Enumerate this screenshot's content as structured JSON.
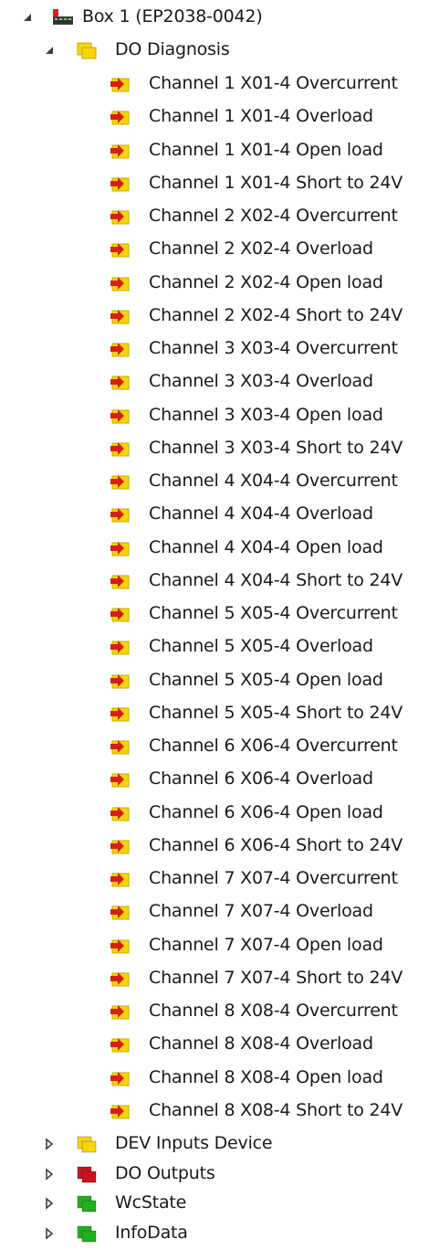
{
  "tree": {
    "root": {
      "label": "Box 1 (EP2038-0042)",
      "icon": "box-device-icon",
      "expanded": true
    },
    "diagnosis_group": {
      "label": "DO Diagnosis",
      "icon": "yellow-folder-icon",
      "expanded": true
    },
    "diagnosis_items": [
      "Channel 1 X01-4 Overcurrent",
      "Channel 1 X01-4 Overload",
      "Channel 1 X01-4 Open load",
      "Channel 1 X01-4 Short to 24V",
      "Channel 2 X02-4 Overcurrent",
      "Channel 2 X02-4 Overload",
      "Channel 2 X02-4 Open load",
      "Channel 2 X02-4 Short to 24V",
      "Channel 3 X03-4 Overcurrent",
      "Channel 3 X03-4 Overload",
      "Channel 3 X03-4 Open load",
      "Channel 3 X03-4 Short to 24V",
      "Channel 4 X04-4 Overcurrent",
      "Channel 4 X04-4 Overload",
      "Channel 4 X04-4 Open load",
      "Channel 4 X04-4 Short to 24V",
      "Channel 5 X05-4 Overcurrent",
      "Channel 5 X05-4 Overload",
      "Channel 5 X05-4 Open load",
      "Channel 5 X05-4 Short to 24V",
      "Channel 6 X06-4 Overcurrent",
      "Channel 6 X06-4 Overload",
      "Channel 6 X06-4 Open load",
      "Channel 6 X06-4 Short to 24V",
      "Channel 7 X07-4 Overcurrent",
      "Channel 7 X07-4 Overload",
      "Channel 7 X07-4 Open load",
      "Channel 7 X07-4 Short to 24V",
      "Channel 8 X08-4 Overcurrent",
      "Channel 8 X08-4 Overload",
      "Channel 8 X08-4 Open load",
      "Channel 8 X08-4 Short to 24V"
    ],
    "diagnosis_item_icon": "input-variable-icon",
    "collapsed_groups": [
      {
        "label": "DEV Inputs Device",
        "icon": "yellow-folder-icon",
        "color": "#f5d60a"
      },
      {
        "label": "DO Outputs",
        "icon": "red-folder-icon",
        "color": "#c8141e"
      },
      {
        "label": "WcState",
        "icon": "green-folder-icon",
        "color": "#22b01e"
      },
      {
        "label": "InfoData",
        "icon": "green-folder-icon",
        "color": "#22b01e"
      }
    ]
  },
  "colors": {
    "expander": "#404040",
    "yellow_folder": "#f5d60a",
    "red_folder": "#c8141e",
    "green_folder": "#22b01e",
    "input_arrow": "#d81e12"
  }
}
